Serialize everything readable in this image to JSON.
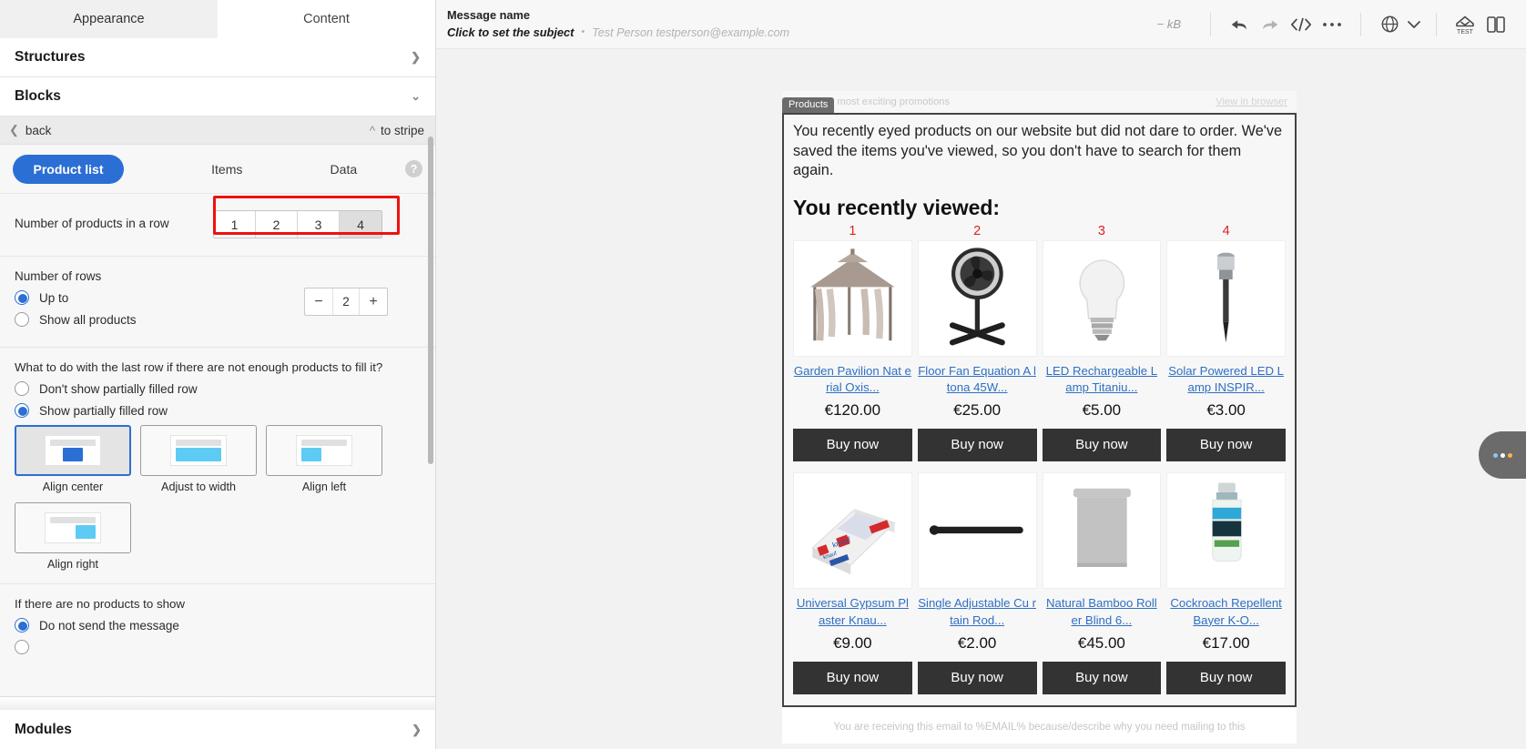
{
  "left_panel": {
    "tabs": [
      {
        "label": "Appearance",
        "active": true
      },
      {
        "label": "Content",
        "active": false
      }
    ],
    "sections": {
      "structures": "Structures",
      "blocks": "Blocks",
      "modules": "Modules"
    },
    "back_bar": {
      "back_label": "back",
      "to_stripe_label": "to stripe"
    },
    "segments": [
      {
        "label": "Product list",
        "active": true
      },
      {
        "label": "Items",
        "active": false
      },
      {
        "label": "Data",
        "active": false
      }
    ],
    "help_icon": "?",
    "products_in_row": {
      "label": "Number of products in a row",
      "options": [
        "1",
        "2",
        "3",
        "4"
      ],
      "selected": "4",
      "highlight_color": "#ee1111"
    },
    "number_of_rows": {
      "label": "Number of rows",
      "options": [
        {
          "label": "Up to",
          "selected": true
        },
        {
          "label": "Show all products",
          "selected": false
        }
      ],
      "stepper": {
        "minus": "−",
        "value": "2",
        "plus": "+"
      }
    },
    "last_row": {
      "question": "What to do with the last row if there are not enough products to fill it?",
      "options": [
        {
          "label": "Don't show partially filled row",
          "selected": false
        },
        {
          "label": "Show partially filled row",
          "selected": true
        }
      ],
      "alignment": [
        {
          "label": "Align center",
          "selected": true
        },
        {
          "label": "Adjust to width",
          "selected": false
        },
        {
          "label": "Align left",
          "selected": false
        },
        {
          "label": "Align right",
          "selected": false
        }
      ]
    },
    "no_products": {
      "label": "If there are no products to show",
      "options": [
        {
          "label": "Do not send the message",
          "selected": true
        }
      ]
    }
  },
  "topbar": {
    "message_name": "Message name",
    "subject_placeholder": "Click to set the subject",
    "separator": "•",
    "sender": "Test Person testperson@example.com",
    "size": "− kB",
    "actions": [
      {
        "name": "undo-icon",
        "label": "Undo"
      },
      {
        "name": "redo-icon",
        "label": "Redo"
      },
      {
        "name": "code-icon",
        "label": "Source code"
      },
      {
        "name": "more-icon",
        "label": "More"
      },
      {
        "name": "globe-icon",
        "label": "Language"
      },
      {
        "name": "test-icon",
        "label": "TEST"
      },
      {
        "name": "device-preview-icon",
        "label": "Preview"
      }
    ]
  },
  "email": {
    "preheader": "der of the most exciting promotions",
    "view_in_browser": "View in browser",
    "block_tag": "Products",
    "intro": "You recently eyed products on our website but did not dare to order. We've saved the items you've viewed, so you don't have to search for them again.",
    "heading": "You recently viewed:",
    "buy_label": "Buy now",
    "footer": "You are receiving this email to %EMAIL% because/describe why you need mailing to this",
    "products": [
      {
        "num": "1",
        "name": "Garden Pavilion Nat erial Oxis...",
        "price": "€120.00",
        "art": "pavilion"
      },
      {
        "num": "2",
        "name": "Floor Fan Equation A ltona 45W...",
        "price": "€25.00",
        "art": "fan"
      },
      {
        "num": "3",
        "name": "LED Rechargeable L amp Titaniu...",
        "price": "€5.00",
        "art": "bulb"
      },
      {
        "num": "4",
        "name": "Solar Powered LED Lamp INSPIR...",
        "price": "€3.00",
        "art": "solar"
      },
      {
        "num": "",
        "name": "Universal Gypsum Pl aster Knau...",
        "price": "€9.00",
        "art": "gypsum"
      },
      {
        "num": "",
        "name": "Single Adjustable Cu rtain Rod...",
        "price": "€2.00",
        "art": "rod"
      },
      {
        "num": "",
        "name": "Natural Bamboo Roll er Blind 6...",
        "price": "€45.00",
        "art": "blind"
      },
      {
        "num": "",
        "name": "Cockroach Repellent Bayer K-O...",
        "price": "€17.00",
        "art": "spray"
      }
    ]
  },
  "side_tab": {
    "name": "more-options-tab",
    "dots": [
      "#8fc0ff",
      "#ffffff",
      "#ffb347"
    ]
  }
}
